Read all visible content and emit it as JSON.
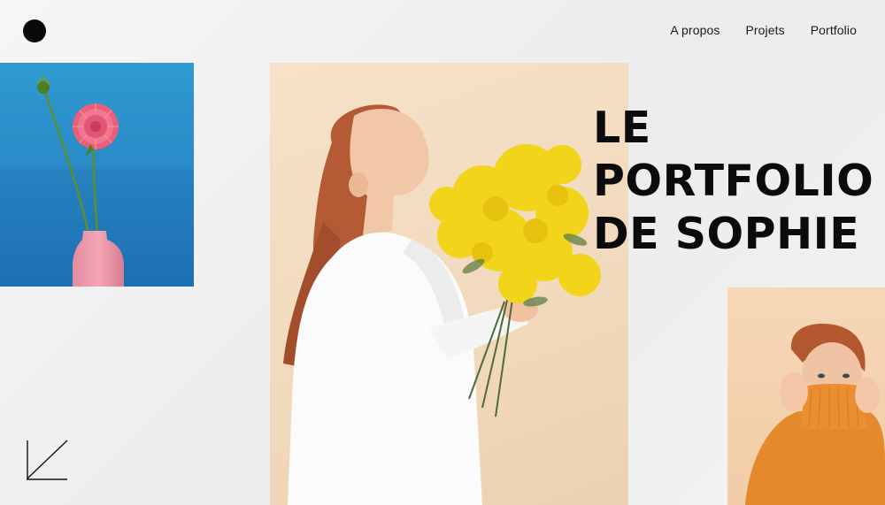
{
  "nav": {
    "items": [
      {
        "label": "A propos"
      },
      {
        "label": "Projets"
      },
      {
        "label": "Portfolio"
      }
    ]
  },
  "hero": {
    "title_lines": [
      "LE",
      "PORTFOLIO",
      "DE SOPHIE"
    ]
  },
  "images": {
    "flower": "pink dahlia in pink vase on blue background",
    "main": "woman in white shirt smelling yellow mimosa bouquet",
    "portrait": "red-haired woman in orange turtleneck"
  },
  "colors": {
    "background": "#efefef",
    "text": "#0b0b0b",
    "flower_bg": "#2a8bc7",
    "main_bg": "#f1d9bc",
    "portrait_bg": "#f3d0aa",
    "accent_yellow": "#f2d41a",
    "accent_orange": "#e58a2c"
  },
  "icons": {
    "logo": "logo-dot-icon",
    "arrow": "arrow-down-left-icon"
  }
}
